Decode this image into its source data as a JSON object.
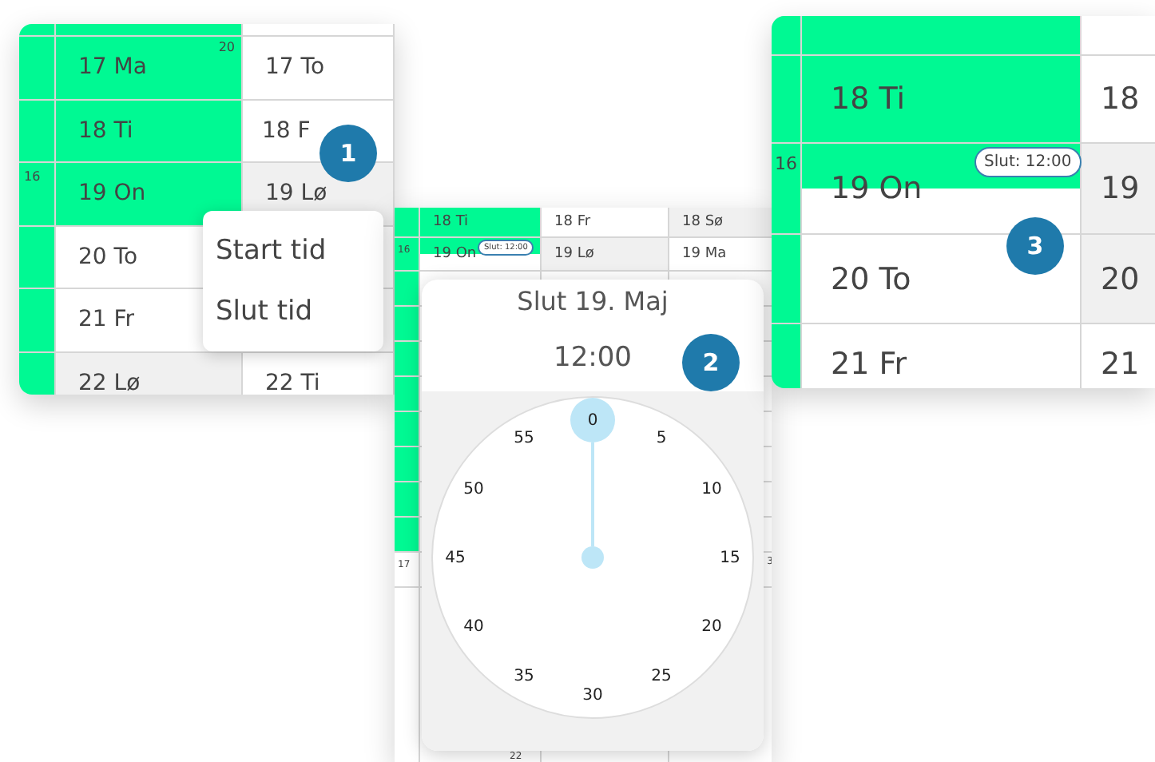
{
  "menu_view": {
    "step": "1",
    "rows": [
      {
        "week": "",
        "cells": [
          {
            "text": "17 Ma",
            "note": "20",
            "highlighted": true,
            "weekend": false
          },
          {
            "text": "17 To",
            "highlighted": false,
            "weekend": false
          }
        ]
      },
      {
        "week": "",
        "cells": [
          {
            "text": "18 Ti",
            "highlighted": true,
            "weekend": false
          },
          {
            "text": "18 F",
            "highlighted": false,
            "weekend": false
          }
        ]
      },
      {
        "week": "16",
        "cells": [
          {
            "text": "19 On",
            "highlighted": true,
            "weekend": false
          },
          {
            "text": "19 Lø",
            "highlighted": false,
            "weekend": true
          }
        ]
      },
      {
        "week": "",
        "cells": [
          {
            "text": "20 To",
            "highlighted": false,
            "weekend": false
          }
        ]
      },
      {
        "week": "",
        "cells": [
          {
            "text": "21 Fr",
            "highlighted": false,
            "weekend": false
          }
        ]
      },
      {
        "week": "",
        "cells": [
          {
            "text": "22 Lø",
            "highlighted": false,
            "weekend": true
          },
          {
            "text": "22 Ti",
            "highlighted": false,
            "weekend": false
          }
        ]
      }
    ],
    "menu_items": [
      "Start tid",
      "Slut tid"
    ]
  },
  "clock_view": {
    "step": "2",
    "rows": [
      {
        "week": "",
        "cells": [
          {
            "text": "18 Ti",
            "highlighted": true,
            "half": false,
            "weekend": false
          },
          {
            "text": "18 Fr",
            "highlighted": false,
            "weekend": false
          },
          {
            "text": "18 Sø",
            "highlighted": false,
            "weekend": true
          }
        ]
      },
      {
        "week": "16",
        "cells": [
          {
            "text": "19 On",
            "highlighted": true,
            "half": true,
            "weekend": false
          },
          {
            "text": "19 Lø",
            "highlighted": false,
            "weekend": true
          },
          {
            "text": "19 Ma",
            "highlighted": false,
            "weekend": false
          }
        ]
      }
    ],
    "end_tag": "Slut: 12:00",
    "lower_week": "17",
    "edge_number": "3",
    "bottom_number": "22",
    "picker": {
      "title": "Slut 19. Maj",
      "time": "12:00",
      "marks": [
        {
          "label": "0",
          "selected": true
        },
        {
          "label": "5",
          "selected": false
        },
        {
          "label": "10",
          "selected": false
        },
        {
          "label": "15",
          "selected": false
        },
        {
          "label": "20",
          "selected": false
        },
        {
          "label": "25",
          "selected": false
        },
        {
          "label": "30",
          "selected": false
        },
        {
          "label": "35",
          "selected": false
        },
        {
          "label": "40",
          "selected": false
        },
        {
          "label": "45",
          "selected": false
        },
        {
          "label": "50",
          "selected": false
        },
        {
          "label": "55",
          "selected": false
        }
      ]
    }
  },
  "detail_view": {
    "step": "3",
    "end_tag": "Slut: 12:00",
    "rows": [
      {
        "week": "",
        "cells": [
          {
            "text": "18 Ti",
            "highlighted": true,
            "half": false,
            "weekend": false
          },
          {
            "text": "18",
            "highlighted": false,
            "weekend": false
          }
        ]
      },
      {
        "week": "16",
        "cells": [
          {
            "text": "19 On",
            "highlighted": true,
            "half": true,
            "weekend": false
          },
          {
            "text": "19",
            "highlighted": false,
            "weekend": true
          }
        ]
      },
      {
        "week": "",
        "cells": [
          {
            "text": "20 To",
            "highlighted": false,
            "weekend": false
          },
          {
            "text": "20",
            "highlighted": false,
            "weekend": true
          }
        ]
      },
      {
        "week": "",
        "cells": [
          {
            "text": "21 Fr",
            "highlighted": false,
            "weekend": false
          },
          {
            "text": "21",
            "highlighted": false,
            "weekend": false
          }
        ]
      }
    ]
  }
}
